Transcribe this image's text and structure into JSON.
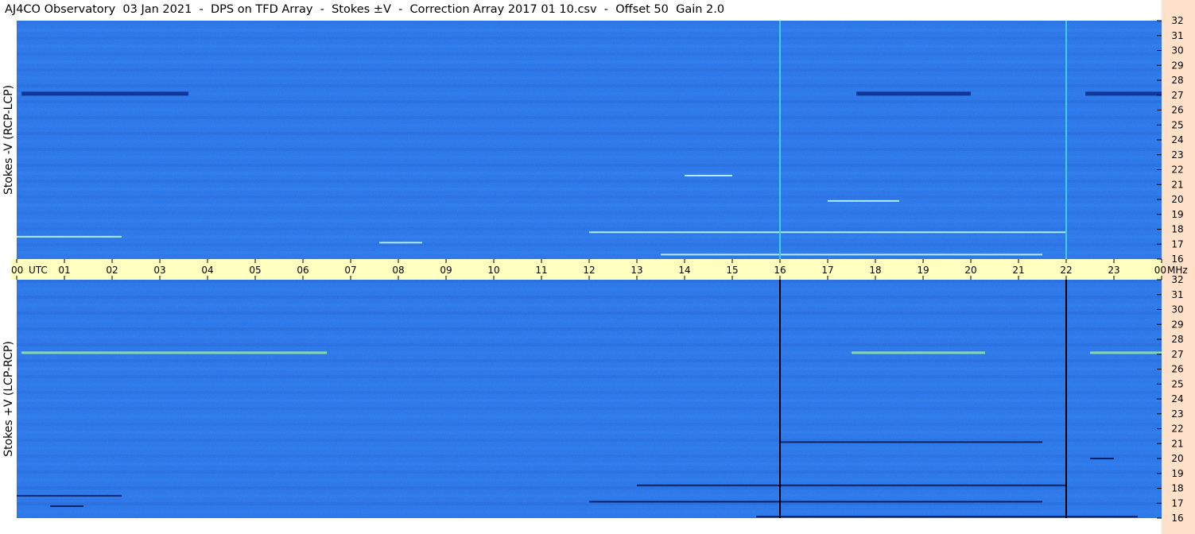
{
  "title": "AJ4CO Observatory  03 Jan 2021  -  DPS on TFD Array  -  Stokes ±V  -  Correction Array 2017 01 10.csv  -  Offset 50  Gain 2.0",
  "colors": {
    "background": "#ffffff",
    "time_strip": "#ffffc0",
    "freq_strip": "#ffe0c8",
    "spectrogram_base": "#1e6ee8",
    "spectrogram_dark": "#0a2a8c",
    "spectrogram_light": "#46a0ff",
    "marker_top": "#3fd0e0",
    "marker_bottom": "#000000"
  },
  "chart_data": [
    {
      "type": "heatmap",
      "panel": "top",
      "ylabel": "Stokes -V (RCP-LCP)",
      "y_ticks": [
        16,
        17,
        18,
        19,
        20,
        21,
        22,
        23,
        24,
        25,
        26,
        27,
        28,
        29,
        30,
        31,
        32
      ],
      "ylim": [
        16,
        32
      ],
      "y_unit": "MHz",
      "xlim": [
        0,
        24
      ],
      "features": [
        {
          "kind": "dark_band",
          "freq": 27.1,
          "start": 0.1,
          "end": 3.6
        },
        {
          "kind": "dark_band",
          "freq": 27.1,
          "start": 17.6,
          "end": 20.0
        },
        {
          "kind": "dark_band",
          "freq": 27.1,
          "start": 22.4,
          "end": 24.0
        },
        {
          "kind": "light_line",
          "freq": 17.5,
          "start": 0.0,
          "end": 2.2
        },
        {
          "kind": "light_line",
          "freq": 21.6,
          "start": 14.0,
          "end": 15.0
        },
        {
          "kind": "light_line",
          "freq": 17.1,
          "start": 7.6,
          "end": 8.5
        },
        {
          "kind": "light_line",
          "freq": 17.8,
          "start": 12.0,
          "end": 22.0
        },
        {
          "kind": "light_line",
          "freq": 16.3,
          "start": 13.5,
          "end": 21.5
        },
        {
          "kind": "light_line",
          "freq": 19.9,
          "start": 17.0,
          "end": 18.5
        }
      ],
      "markers": [
        16.0,
        22.0
      ]
    },
    {
      "type": "heatmap",
      "panel": "bottom",
      "ylabel": "Stokes +V (LCP-RCP)",
      "y_ticks": [
        16,
        17,
        18,
        19,
        20,
        21,
        22,
        23,
        24,
        25,
        26,
        27,
        28,
        29,
        30,
        31,
        32
      ],
      "ylim": [
        16,
        32
      ],
      "y_unit": "MHz",
      "xlim": [
        0,
        24
      ],
      "features": [
        {
          "kind": "light_band",
          "freq": 27.1,
          "start": 0.1,
          "end": 6.5
        },
        {
          "kind": "light_band",
          "freq": 27.1,
          "start": 17.5,
          "end": 20.3
        },
        {
          "kind": "light_band",
          "freq": 27.1,
          "start": 22.5,
          "end": 24.0
        },
        {
          "kind": "dark_line",
          "freq": 17.5,
          "start": 0.0,
          "end": 2.2
        },
        {
          "kind": "dark_line",
          "freq": 16.8,
          "start": 0.7,
          "end": 1.4
        },
        {
          "kind": "dark_line",
          "freq": 18.2,
          "start": 13.0,
          "end": 22.0
        },
        {
          "kind": "dark_line",
          "freq": 17.1,
          "start": 12.0,
          "end": 21.5
        },
        {
          "kind": "dark_line",
          "freq": 16.1,
          "start": 15.5,
          "end": 23.5
        },
        {
          "kind": "dark_line",
          "freq": 21.1,
          "start": 16.0,
          "end": 21.5
        },
        {
          "kind": "dark_line",
          "freq": 20.0,
          "start": 22.5,
          "end": 23.0
        }
      ],
      "markers": [
        16.0,
        22.0
      ]
    }
  ],
  "time_axis": {
    "ticks": [
      "00",
      "01",
      "02",
      "03",
      "04",
      "05",
      "06",
      "07",
      "08",
      "09",
      "10",
      "11",
      "12",
      "13",
      "14",
      "15",
      "16",
      "17",
      "18",
      "19",
      "20",
      "21",
      "22",
      "23",
      "00"
    ],
    "start_unit": "UTC",
    "end_unit": "MHz"
  }
}
